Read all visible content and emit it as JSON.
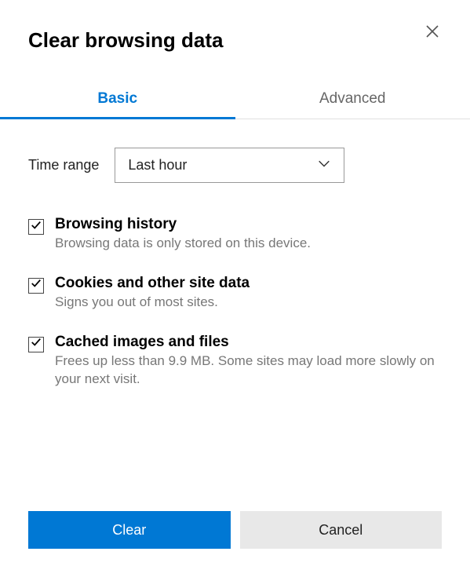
{
  "header": {
    "title": "Clear browsing data"
  },
  "tabs": {
    "basic": "Basic",
    "advanced": "Advanced"
  },
  "time_range": {
    "label": "Time range",
    "selected": "Last hour"
  },
  "options": [
    {
      "title": "Browsing history",
      "description": "Browsing data is only stored on this device.",
      "checked": true
    },
    {
      "title": "Cookies and other site data",
      "description": "Signs you out of most sites.",
      "checked": true
    },
    {
      "title": "Cached images and files",
      "description": "Frees up less than 9.9 MB. Some sites may load more slowly on your next visit.",
      "checked": true
    }
  ],
  "buttons": {
    "clear": "Clear",
    "cancel": "Cancel"
  }
}
